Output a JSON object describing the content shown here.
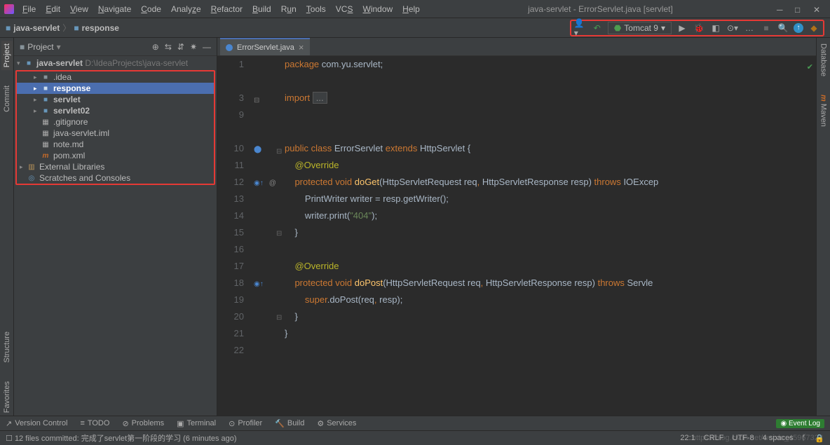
{
  "window": {
    "title": "java-servlet - ErrorServlet.java [servlet]"
  },
  "menu": [
    "File",
    "Edit",
    "View",
    "Navigate",
    "Code",
    "Analyze",
    "Refactor",
    "Build",
    "Run",
    "Tools",
    "VCS",
    "Window",
    "Help"
  ],
  "breadcrumb": {
    "project": "java-servlet",
    "module": "response"
  },
  "runbar": {
    "config": "Tomcat 9"
  },
  "project_panel": {
    "title": "Project"
  },
  "tree": {
    "root": {
      "label": "java-servlet",
      "path": "D:\\IdeaProjects\\java-servlet"
    },
    "idea": ".idea",
    "response": "response",
    "servlet": "servlet",
    "servlet02": "servlet02",
    "gitignore": ".gitignore",
    "iml": "java-servlet.iml",
    "note": "note.md",
    "pom": "pom.xml",
    "ext": "External Libraries",
    "scratch": "Scratches and Consoles"
  },
  "tabs": {
    "file": "ErrorServlet.java"
  },
  "code": {
    "l1a": "package",
    "l1b": " com.yu.servlet",
    "l3a": "import ",
    "l3b": "...",
    "l11a": "public class ",
    "l11b": "ErrorServlet ",
    "l11c": "extends ",
    "l11d": "HttpServlet {",
    "l12": "@Override",
    "l13a": "    protected void ",
    "l13m": "doGet",
    "l13b": "(HttpServletRequest req",
    "l13c": ", ",
    "l13d": "HttpServletResponse resp) ",
    "l13e": "throws ",
    "l13f": "IOExcep",
    "l14a": "        PrintWriter writer = resp.getWriter();",
    "l15a": "        writer.print(",
    "l15b": "\"404\"",
    "l15c": ");",
    "l16": "    }",
    "l18": "@Override",
    "l19a": "    protected void ",
    "l19m": "doPost",
    "l19b": "(HttpServletRequest req",
    "l19c": ", ",
    "l19d": "HttpServletResponse resp) ",
    "l19e": "throws ",
    "l19f": "Servle",
    "l20a": "        super",
    "l20b": ".doPost(req",
    "l20c": ", ",
    "l20d": "resp);",
    "l21": "    }",
    "l22": "}"
  },
  "linenos": [
    "1",
    "",
    "3",
    "9",
    "",
    "10",
    "11",
    "12",
    "13",
    "14",
    "15",
    "16",
    "17",
    "18",
    "19",
    "20",
    "21",
    "22"
  ],
  "rightpanel": {
    "db": "Database",
    "mvn": "Maven"
  },
  "leftpanel": {
    "project": "Project",
    "commit": "Commit",
    "structure": "Structure",
    "favorites": "Favorites"
  },
  "statusbar_tools": {
    "vcs": "Version Control",
    "todo": "TODO",
    "problems": "Problems",
    "terminal": "Terminal",
    "profiler": "Profiler",
    "build": "Build",
    "services": "Services",
    "eventlog": "Event Log"
  },
  "statusbar": {
    "commit_msg": "12 files committed: 完成了servlet第一阶段的学习 (6 minutes ago)",
    "pos": "22:1",
    "lf": "CRLF",
    "enc": "UTF-8",
    "indent": "4 spaces",
    "watermark": "https://blog.csdn.net/weixin_45967322"
  }
}
